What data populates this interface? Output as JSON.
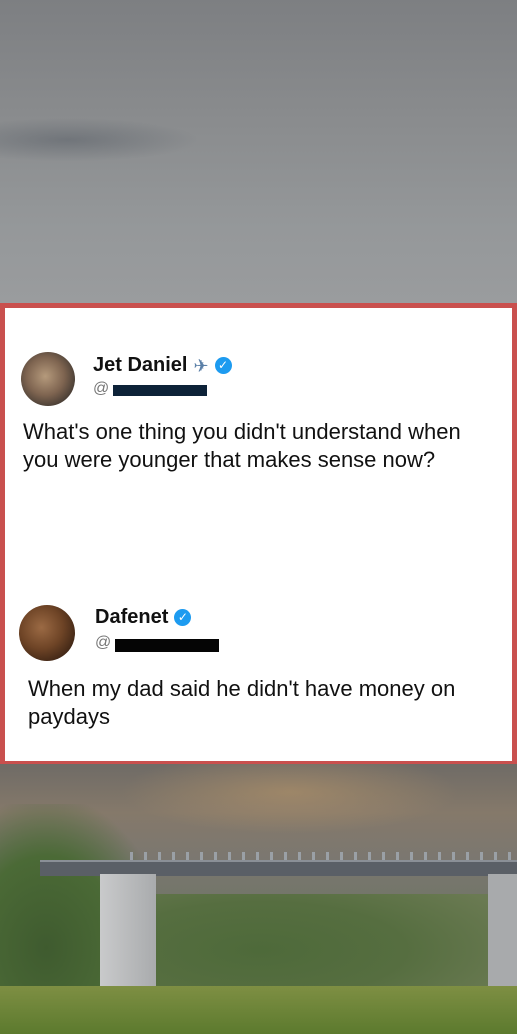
{
  "tweets": [
    {
      "name": "Jet Daniel",
      "name_emoji": "✈",
      "handle": "@",
      "text": "What's one thing you didn't understand when you were younger that makes sense now?"
    },
    {
      "name": "Dafenet",
      "handle": "@",
      "text": "When my dad said he didn't have money on paydays"
    }
  ],
  "colors": {
    "card_border": "#c9504e",
    "verified": "#1d9bf0"
  }
}
